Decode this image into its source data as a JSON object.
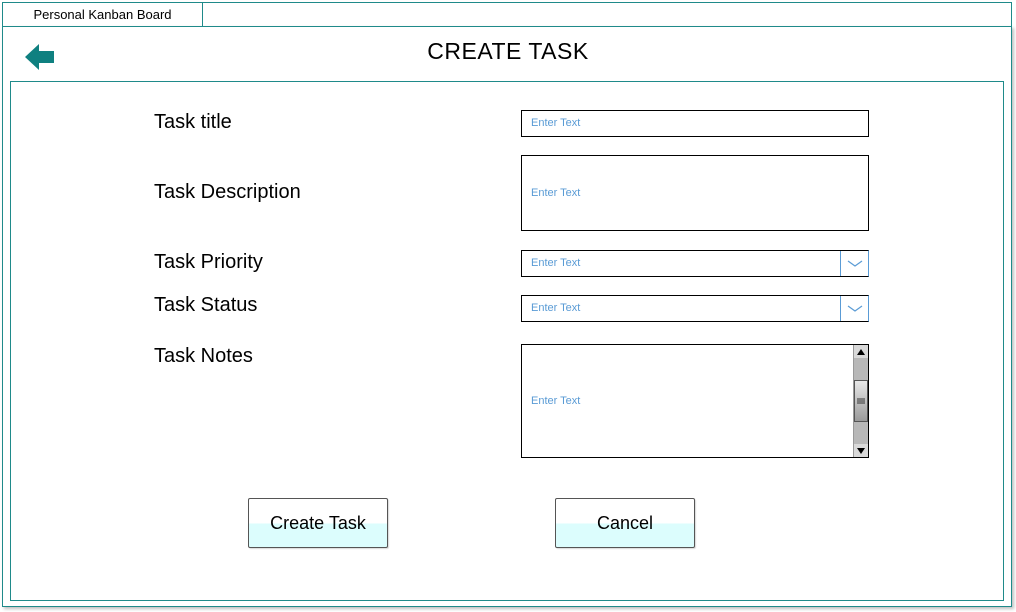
{
  "window": {
    "tab_title": "Personal Kanban Board"
  },
  "header": {
    "title": "CREATE TASK",
    "back_icon": "arrow-left-icon"
  },
  "form": {
    "title_label": "Task title",
    "title_placeholder": "Enter Text",
    "description_label": "Task Description",
    "description_placeholder": "Enter Text",
    "priority_label": "Task Priority",
    "priority_value": "Enter Text",
    "status_label": "Task Status",
    "status_value": "Enter Text",
    "notes_label": "Task Notes",
    "notes_placeholder": "Enter Text"
  },
  "actions": {
    "create_label": "Create Task",
    "cancel_label": "Cancel"
  },
  "colors": {
    "accent": "#1f8a8a",
    "placeholder": "#5a9bd5",
    "button_fill": "#dcfdfd"
  }
}
